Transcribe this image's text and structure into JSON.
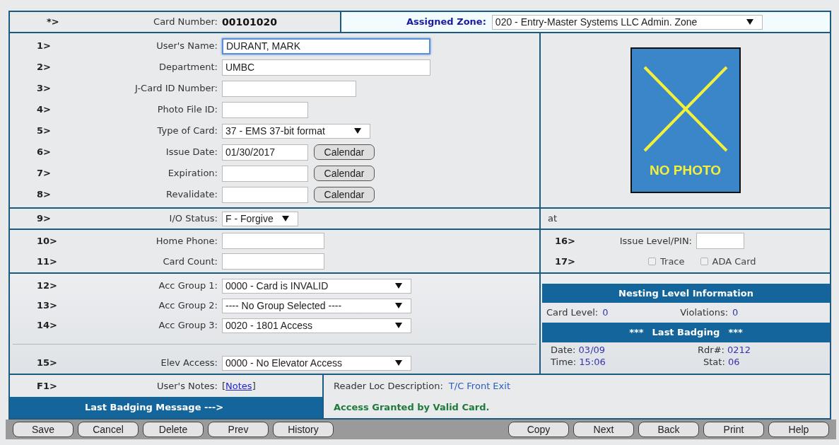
{
  "header": {
    "row_label": "*>",
    "card_number_label": "Card Number:",
    "card_number": "00101020",
    "zone_label": "Assigned Zone:",
    "zone_value": "020 - Entry-Master Systems LLC Admin. Zone"
  },
  "main_fields": [
    {
      "number": "1>",
      "label": "User's Name:",
      "kind": "text",
      "value": "DURANT, MARK",
      "focused": true
    },
    {
      "number": "2>",
      "label": "Department:",
      "kind": "text",
      "value": "UMBC",
      "focused": false
    },
    {
      "number": "3>",
      "label": "J-Card ID Number:",
      "kind": "text",
      "focused": false
    },
    {
      "number": "4>",
      "label": "Photo File ID:",
      "kind": "text",
      "focused": false
    },
    {
      "number": "5>",
      "label": "Type of Card:",
      "kind": "select",
      "value": "37 - EMS 37-bit format",
      "focused": false
    },
    {
      "number": "6>",
      "label": "Issue Date:",
      "kind": "date",
      "value": "01/30/2017",
      "button": "Calendar",
      "focused": false
    },
    {
      "number": "7>",
      "label": "Expiration:",
      "kind": "date",
      "button": "Calendar",
      "focused": false
    },
    {
      "number": "8>",
      "label": "Revalidate:",
      "kind": "date",
      "button": "Calendar",
      "focused": false
    }
  ],
  "photo": {
    "caption": "NO PHOTO"
  },
  "io_status": {
    "number": "9>",
    "label": "I/O Status:",
    "kind": "select",
    "value": "F - Forgive",
    "note": "at"
  },
  "contact_fields": [
    {
      "number": "10>",
      "label": "Home Phone:",
      "kind": "text"
    },
    {
      "number": "11>",
      "label": "Card Count:",
      "kind": "text"
    }
  ],
  "issue_level": {
    "number": "16>",
    "label": "Issue Level/PIN:"
  },
  "options": {
    "number": "17>",
    "checkboxes": [
      {
        "label": "Trace",
        "checked": false
      },
      {
        "label": "ADA Card",
        "checked": false
      }
    ]
  },
  "access_groups": [
    {
      "number": "12>",
      "label": "Acc Group 1:",
      "kind": "select",
      "value": "0000 - Card is INVALID"
    },
    {
      "number": "13>",
      "label": "Acc Group 2:",
      "kind": "select",
      "value": "---- No Group Selected ----"
    },
    {
      "number": "14>",
      "label": "Acc Group 3:",
      "kind": "select",
      "value": "0020 - 1801 Access"
    }
  ],
  "elevator": {
    "number": "15>",
    "label": "Elev Access:",
    "kind": "select",
    "value": "0000 - No Elevator Access"
  },
  "nesting": {
    "title": "Nesting Level Information",
    "card_level_label": "Card Level:",
    "card_level": "0",
    "violations_label": "Violations:",
    "violations": "0"
  },
  "last_badging": {
    "title_stars_left": "***",
    "title": "Last Badging",
    "title_stars_right": "***",
    "date_label": "Date:",
    "date": "03/09",
    "time_label": "Time:",
    "time": "15:06",
    "reader_label": "Rdr#:",
    "reader": "0212",
    "stat_label": "Stat:",
    "stat": "06"
  },
  "notes": {
    "number": "F1>",
    "label": "User's Notes:",
    "bracket_open": "[",
    "link": "Notes",
    "bracket_close": "]",
    "reader_loc_label": "Reader Loc Description:",
    "reader_loc": "T/C Front Exit"
  },
  "message": {
    "label": "Last Badging Message --->",
    "text": "Access Granted by Valid Card."
  },
  "buttons_left": [
    "Save",
    "Cancel",
    "Delete",
    "Prev",
    "History"
  ],
  "buttons_right": [
    "Copy",
    "Next",
    "Back",
    "Print",
    "Help"
  ]
}
